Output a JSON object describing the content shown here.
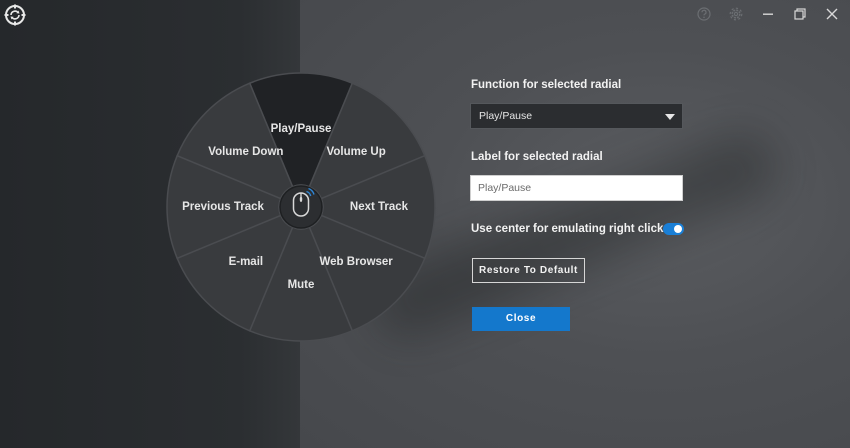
{
  "window": {
    "logo_icon": "gear-refresh-icon",
    "controls": [
      "help-icon",
      "settings-icon",
      "minimize-icon",
      "maximize-icon",
      "close-icon"
    ]
  },
  "radial": {
    "center_icon": "mouse-icon",
    "selected": "Play/Pause",
    "segments": [
      {
        "label": "Play/Pause"
      },
      {
        "label": "Volume Up"
      },
      {
        "label": "Next Track"
      },
      {
        "label": "Web Browser"
      },
      {
        "label": "Mute"
      },
      {
        "label": "E-mail"
      },
      {
        "label": "Previous Track"
      },
      {
        "label": "Volume Down"
      }
    ]
  },
  "panel": {
    "function_label": "Function for selected radial",
    "function_value": "Play/Pause",
    "label_label": "Label for selected radial",
    "label_value": "Play/Pause",
    "center_toggle_label": "Use center for emulating right click",
    "center_toggle_on": true,
    "restore_button": "Restore To Default",
    "close_button": "Close"
  },
  "colors": {
    "accent": "#1478cc",
    "segment_selected": "#202225",
    "segment_default": "#393b3e"
  }
}
